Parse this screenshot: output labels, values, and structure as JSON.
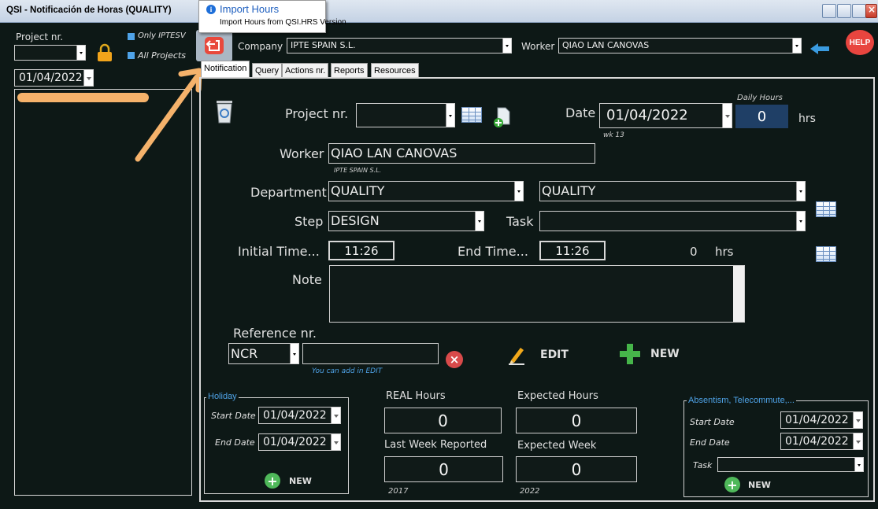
{
  "window": {
    "title": "QSI - Notificación de Horas (QUALITY)"
  },
  "tooltip": {
    "title": "Import Hours",
    "body": "Import Hours from QSI.HRS Version"
  },
  "left_panel": {
    "project_label": "Project nr.",
    "project_value": "",
    "only_iptesv": "Only IPTESV",
    "all_projects": "All Projects",
    "date": "01/04/2022"
  },
  "header": {
    "company_label": "Company",
    "company_value": "IPTE SPAIN S.L.",
    "worker_label": "Worker",
    "worker_value": "QIAO LAN CANOVAS",
    "help_label": "HELP"
  },
  "tabs": [
    {
      "label": "Notification",
      "active": true
    },
    {
      "label": "Query"
    },
    {
      "label": "Actions nr."
    },
    {
      "label": "Reports"
    },
    {
      "label": "Resources"
    }
  ],
  "form": {
    "project_label": "Project nr.",
    "project_value": "",
    "date_label": "Date",
    "date_value": "01/04/2022",
    "week": "wk 13",
    "daily_hours_label": "Daily Hours",
    "daily_hours_value": "0",
    "hrs": "hrs",
    "worker_label": "Worker",
    "worker_value": "QIAO LAN CANOVAS",
    "worker_company": "IPTE SPAIN S.L.",
    "department_label": "Department",
    "department_value": "QUALITY",
    "department_value2": "QUALITY",
    "step_label": "Step",
    "step_value": "DESIGN",
    "task_label": "Task",
    "task_value": "",
    "initial_time_label": "Initial Time...",
    "initial_time_value": "11:26",
    "end_time_label": "End Time...",
    "end_time_value": "11:26",
    "total_value": "0",
    "total_unit": "hrs",
    "note_label": "Note",
    "note_value": "",
    "reference_label": "Reference nr.",
    "reference_type": "NCR",
    "reference_value": "",
    "reference_hint": "You can add in EDIT",
    "edit_label": "EDIT",
    "new_label": "NEW"
  },
  "holiday": {
    "legend": "Holiday",
    "start_label": "Start Date",
    "start_value": "01/04/2022",
    "end_label": "End Date",
    "end_value": "01/04/2022",
    "new_label": "NEW"
  },
  "stats": {
    "real_hours_label": "REAL Hours",
    "real_hours_value": "0",
    "expected_hours_label": "Expected Hours",
    "expected_hours_value": "0",
    "last_week_label": "Last Week Reported",
    "last_week_value": "0",
    "last_week_year": "2017",
    "expected_week_label": "Expected Week",
    "expected_week_value": "0",
    "expected_week_year": "2022"
  },
  "absentism": {
    "legend": "Absentism, Telecommute,...",
    "start_label": "Start Date",
    "start_value": "01/04/2022",
    "end_label": "End Date",
    "end_value": "01/04/2022",
    "task_label": "Task",
    "task_value": "",
    "new_label": "NEW"
  },
  "colors": {
    "background": "#0d1816",
    "accent_blue": "#4fa3e8",
    "tooltip_info": "#1e6fd9",
    "highlight_orange": "#f5b26b",
    "import_button": "#e8493c"
  }
}
